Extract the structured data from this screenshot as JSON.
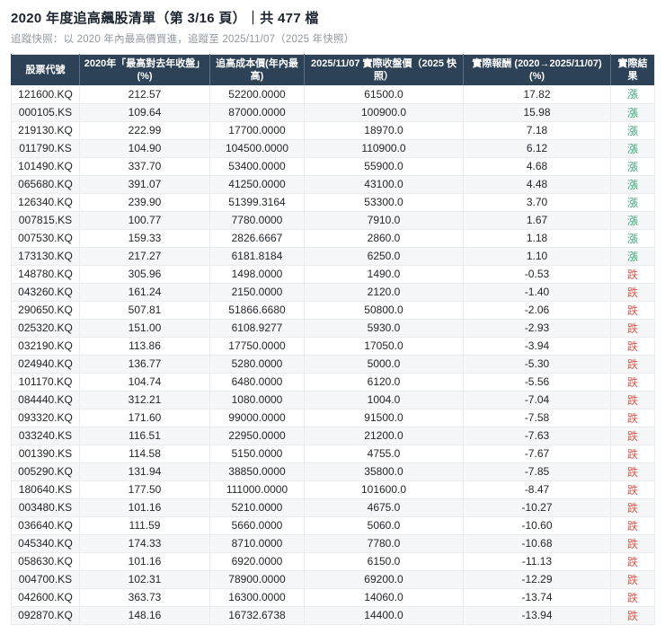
{
  "header": {
    "title": "2020 年度追高飆股清單（第 3/16 頁）｜共 477 檔",
    "subtitle": "追蹤快照：以 2020 年內最高價買進，追蹤至 2025/11/07（2025 年快照）"
  },
  "colors": {
    "header_bg": "#2e4257",
    "header_text": "#ffffff",
    "up_green": "#3aa873",
    "down_red": "#e0584a",
    "row_stripe": "#f6f7f9"
  },
  "result_labels": {
    "up": "漲",
    "down": "跌"
  },
  "chart_data": {
    "type": "table",
    "title": "2020 年度追高飆股清單（第 3/16 頁）｜共 477 檔",
    "subtitle": "追蹤快照：以 2020 年內最高價買進，追蹤至 2025/11/07（2025 年快照）",
    "page": "3/16",
    "total_count": 477,
    "columns": [
      "股票代號",
      "2020年「最高對去年收盤」(%)",
      "追高成本價(年內最高)",
      "2025/11/07 實際收盤價（2025 快照）",
      "實際報酬\n(2020→2025/11/07) (%)",
      "實際結果"
    ],
    "rows": [
      [
        "121600.KQ",
        "212.57",
        "52200.0000",
        "61500.0",
        "17.82",
        "漲"
      ],
      [
        "000105.KS",
        "109.64",
        "87000.0000",
        "100900.0",
        "15.98",
        "漲"
      ],
      [
        "219130.KQ",
        "222.99",
        "17700.0000",
        "18970.0",
        "7.18",
        "漲"
      ],
      [
        "011790.KS",
        "104.90",
        "104500.0000",
        "110900.0",
        "6.12",
        "漲"
      ],
      [
        "101490.KQ",
        "337.70",
        "53400.0000",
        "55900.0",
        "4.68",
        "漲"
      ],
      [
        "065680.KQ",
        "391.07",
        "41250.0000",
        "43100.0",
        "4.48",
        "漲"
      ],
      [
        "126340.KQ",
        "239.90",
        "51399.3164",
        "53300.0",
        "3.70",
        "漲"
      ],
      [
        "007815.KS",
        "100.77",
        "7780.0000",
        "7910.0",
        "1.67",
        "漲"
      ],
      [
        "007530.KQ",
        "159.33",
        "2826.6667",
        "2860.0",
        "1.18",
        "漲"
      ],
      [
        "173130.KQ",
        "217.27",
        "6181.8184",
        "6250.0",
        "1.10",
        "漲"
      ],
      [
        "148780.KQ",
        "305.96",
        "1498.0000",
        "1490.0",
        "-0.53",
        "跌"
      ],
      [
        "043260.KQ",
        "161.24",
        "2150.0000",
        "2120.0",
        "-1.40",
        "跌"
      ],
      [
        "290650.KQ",
        "507.81",
        "51866.6680",
        "50800.0",
        "-2.06",
        "跌"
      ],
      [
        "025320.KQ",
        "151.00",
        "6108.9277",
        "5930.0",
        "-2.93",
        "跌"
      ],
      [
        "032190.KQ",
        "113.86",
        "17750.0000",
        "17050.0",
        "-3.94",
        "跌"
      ],
      [
        "024940.KQ",
        "136.77",
        "5280.0000",
        "5000.0",
        "-5.30",
        "跌"
      ],
      [
        "101170.KQ",
        "104.74",
        "6480.0000",
        "6120.0",
        "-5.56",
        "跌"
      ],
      [
        "084440.KQ",
        "312.21",
        "1080.0000",
        "1004.0",
        "-7.04",
        "跌"
      ],
      [
        "093320.KQ",
        "171.60",
        "99000.0000",
        "91500.0",
        "-7.58",
        "跌"
      ],
      [
        "033240.KS",
        "116.51",
        "22950.0000",
        "21200.0",
        "-7.63",
        "跌"
      ],
      [
        "001390.KS",
        "114.58",
        "5150.0000",
        "4755.0",
        "-7.67",
        "跌"
      ],
      [
        "005290.KQ",
        "131.94",
        "38850.0000",
        "35800.0",
        "-7.85",
        "跌"
      ],
      [
        "180640.KS",
        "177.50",
        "111000.0000",
        "101600.0",
        "-8.47",
        "跌"
      ],
      [
        "003480.KS",
        "101.16",
        "5210.0000",
        "4675.0",
        "-10.27",
        "跌"
      ],
      [
        "036640.KQ",
        "111.59",
        "5660.0000",
        "5060.0",
        "-10.60",
        "跌"
      ],
      [
        "045340.KQ",
        "174.33",
        "8710.0000",
        "7780.0",
        "-10.68",
        "跌"
      ],
      [
        "058630.KQ",
        "101.16",
        "6920.0000",
        "6150.0",
        "-11.13",
        "跌"
      ],
      [
        "004700.KS",
        "102.31",
        "78900.0000",
        "69200.0",
        "-12.29",
        "跌"
      ],
      [
        "042600.KQ",
        "363.73",
        "16300.0000",
        "14060.0",
        "-13.74",
        "跌"
      ],
      [
        "092870.KQ",
        "148.16",
        "16732.6738",
        "14400.0",
        "-13.94",
        "跌"
      ]
    ]
  }
}
